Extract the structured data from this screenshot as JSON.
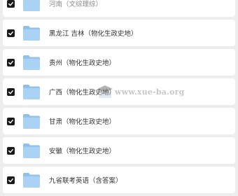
{
  "folders": [
    {
      "name": "河南（文综理综）",
      "checked": true
    },
    {
      "name": "黑龙江 吉林（物化生政史地）",
      "checked": true
    },
    {
      "name": "贵州（物化生政史地）",
      "checked": true
    },
    {
      "name": "广西（物化生政史地）",
      "checked": true
    },
    {
      "name": "甘肃（物化生政史地）",
      "checked": true
    },
    {
      "name": "安徽（物化生政史地）",
      "checked": true
    },
    {
      "name": "九省联考英语（含答案）",
      "checked": true
    }
  ],
  "watermark": {
    "text": "www.xue-ba.org"
  },
  "colors": {
    "folder_back": "#8fc0ec",
    "folder_front": "#a9d2f5",
    "checkbox": "#1a1a1a"
  },
  "icons": {
    "checkbox": "check-icon",
    "folder": "folder-icon",
    "watermark": "graduation-cap-icon"
  }
}
